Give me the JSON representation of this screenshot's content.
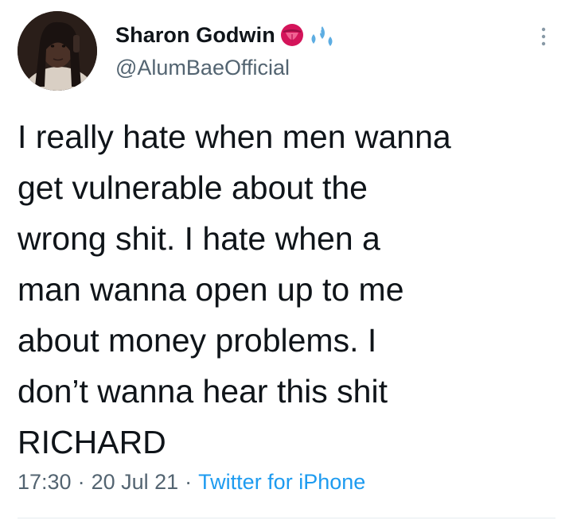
{
  "tweet": {
    "author": {
      "display_name": "Sharon Godwin",
      "handle": "@AlumBaeOfficial",
      "name_emojis": [
        "tongue-emoji",
        "sweat-droplets-emoji"
      ],
      "avatar": "profile-photo"
    },
    "text": "I really hate when men wanna\nget vulnerable about the\nwrong shit. I hate when a\nman wanna open up to me\nabout money problems. I\ndon’t wanna hear this shit\nRICHARD",
    "time": "17:30",
    "separator": "·",
    "date": "20 Jul 21",
    "source": "Twitter for iPhone",
    "menu_icon": "more-vertical-icon"
  },
  "colors": {
    "text": "#0f1419",
    "secondary_text": "#536471",
    "link": "#1d9bf0",
    "divider": "#e6ecf0"
  }
}
